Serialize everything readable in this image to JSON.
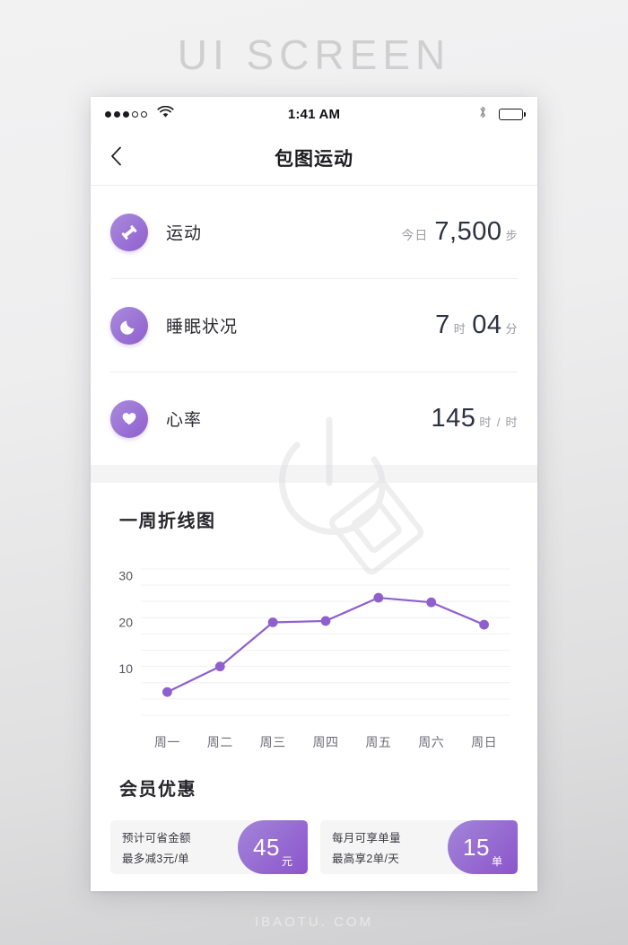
{
  "page": {
    "watermark_title": "UI SCREEN",
    "footer": "IBAOTU. COM"
  },
  "status_bar": {
    "signal_icon": "signal-dots-icon",
    "wifi_icon": "wifi-icon",
    "time": "1:41 AM",
    "bluetooth_icon": "bluetooth-icon",
    "battery_icon": "battery-icon"
  },
  "nav": {
    "back_icon": "chevron-left-icon",
    "title": "包图运动"
  },
  "stats": [
    {
      "icon": "dumbbell-icon",
      "label": "运动",
      "prefix": "今日",
      "value": "7,500",
      "unit": "步",
      "mid": "",
      "value2": "",
      "unit2": ""
    },
    {
      "icon": "moon-icon",
      "label": "睡眠状况",
      "prefix": "",
      "value": "7",
      "unit": "时",
      "mid": "",
      "value2": "04",
      "unit2": "分"
    },
    {
      "icon": "heart-icon",
      "label": "心率",
      "prefix": "",
      "value": "145",
      "unit": "时",
      "mid": "/",
      "value2": "",
      "unit2": "时"
    }
  ],
  "chart_section": {
    "title": "一周折线图"
  },
  "chart_data": {
    "type": "line",
    "title": "一周折线图",
    "xlabel": "",
    "ylabel": "",
    "categories": [
      "周一",
      "周二",
      "周三",
      "周四",
      "周五",
      "周六",
      "周日"
    ],
    "values": [
      5,
      10.5,
      20,
      20.3,
      25.3,
      24.3,
      19.5
    ],
    "yticks": [
      10,
      20,
      30
    ],
    "ylim": [
      0,
      34
    ],
    "gridlines": [
      0,
      3.5,
      7,
      10.5,
      14,
      17.5,
      21,
      24.5,
      28,
      31.5
    ],
    "grid": true,
    "legend": "none",
    "line_color": "#8f5fce",
    "point_color": "#8f5fce"
  },
  "member_section": {
    "title": "会员优惠",
    "cards": [
      {
        "line1": "预计可省金额",
        "line2": "最多减3元/单",
        "badge_number": "45",
        "badge_unit": "元"
      },
      {
        "line1": "每月可享单量",
        "line2": "最高享2单/天",
        "badge_number": "15",
        "badge_unit": "单"
      }
    ]
  },
  "colors": {
    "accent": "#8f5fce",
    "accent_light": "#a98bdd",
    "text_dark": "#2d3142",
    "text_muted": "#9b9ba2",
    "band": "#f4f4f5"
  }
}
